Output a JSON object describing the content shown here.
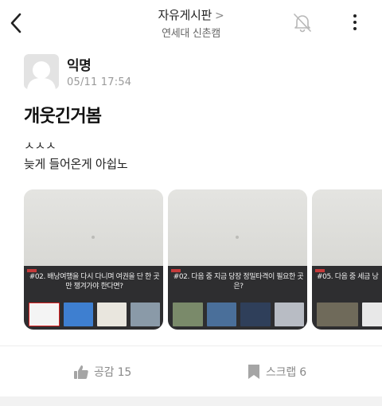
{
  "header": {
    "board_title": "자유게시판",
    "board_chevron": ">",
    "school": "연세대 신촌캠",
    "icons": [
      "back-arrow-icon",
      "bell-off-icon",
      "more-vertical-icon"
    ]
  },
  "post": {
    "author": "익명",
    "time": "05/11 17:54",
    "title": "개웃긴거봄",
    "body_line1": "ㅅㅅㅅ",
    "body_line2": "늦게 들어온게 아쉽노"
  },
  "images": [
    {
      "question": "#02. 배낭여행을 다시 다니며 여권을 단 한 곳만 챙겨가야 한다면?"
    },
    {
      "question": "#02. 다음 중 지금 당장 정밀타격이 필요한 곳은?"
    },
    {
      "question": "#05. 다음 중 세금 낭"
    }
  ],
  "actions": {
    "like_label": "공감 15",
    "scrap_label": "스크랩 6"
  },
  "colors": {
    "muted": "#8a8a8a",
    "divider": "#ececec",
    "avatar_bg": "#e3e3e3"
  }
}
